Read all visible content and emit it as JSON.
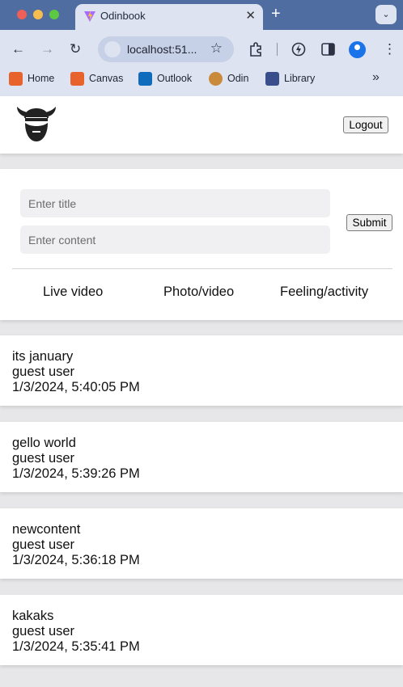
{
  "browser": {
    "tab_title": "Odinbook",
    "url": "localhost:51...",
    "bookmarks": [
      {
        "label": "Home",
        "icon": "home-bookmark-icon",
        "color": "#e8622c"
      },
      {
        "label": "Canvas",
        "icon": "canvas-bookmark-icon",
        "color": "#e8622c"
      },
      {
        "label": "Outlook",
        "icon": "outlook-bookmark-icon",
        "color": "#0f6cbd"
      },
      {
        "label": "Odin",
        "icon": "odin-bookmark-icon",
        "color": "#c98a3a"
      },
      {
        "label": "Library",
        "icon": "library-bookmark-icon",
        "color": "#3a4e8c"
      }
    ]
  },
  "header": {
    "logout_label": "Logout"
  },
  "composer": {
    "title_placeholder": "Enter title",
    "content_placeholder": "Enter content",
    "submit_label": "Submit",
    "actions": [
      "Live video",
      "Photo/video",
      "Feeling/activity"
    ]
  },
  "posts": [
    {
      "title": "its january",
      "author": "guest user",
      "date": "1/3/2024, 5:40:05 PM"
    },
    {
      "title": "gello world",
      "author": "guest user",
      "date": "1/3/2024, 5:39:26 PM"
    },
    {
      "title": "newcontent",
      "author": "guest user",
      "date": "1/3/2024, 5:36:18 PM"
    },
    {
      "title": "kakaks",
      "author": "guest user",
      "date": "1/3/2024, 5:35:41 PM"
    }
  ]
}
